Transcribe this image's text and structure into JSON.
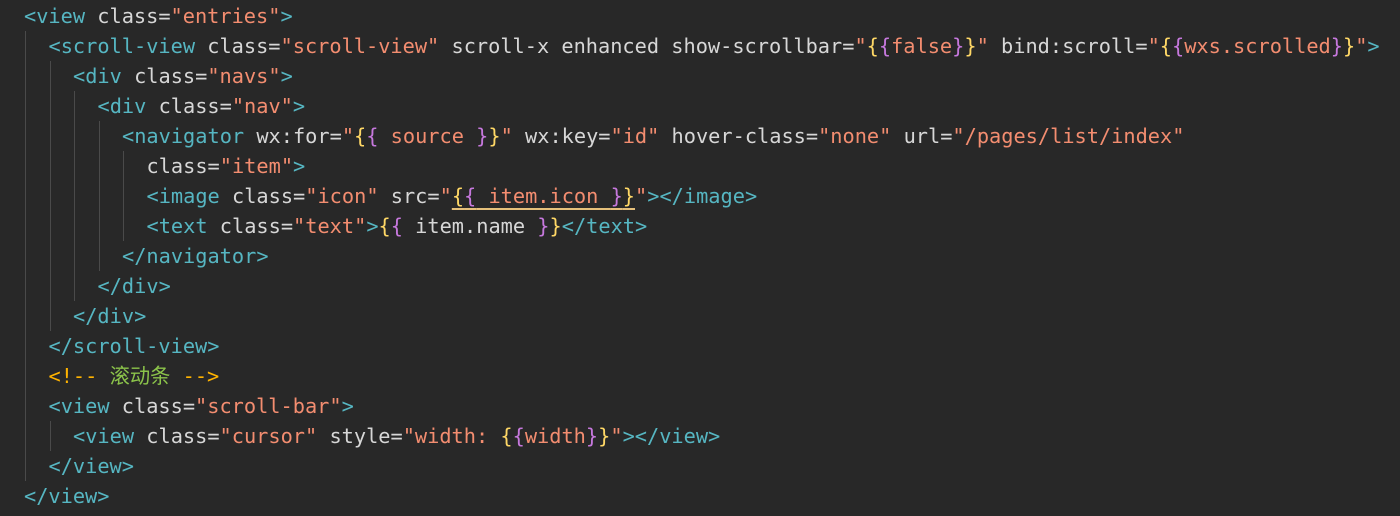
{
  "theme": {
    "background": "#282828",
    "tag": "#56b6c2",
    "bracket": "#56b6c2",
    "attr": "#d7d7d7",
    "string": "#f38d70",
    "brace_yellow": "#ffd866",
    "brace_magenta": "#c678dd",
    "expr": "#d7d7d7",
    "comment": "#8bc34a",
    "comment_delim": "#ffb300",
    "guide": "#4a4a4a"
  },
  "lines": [
    {
      "indent": 0,
      "tokens": [
        {
          "t": "<",
          "k": "tag"
        },
        {
          "t": "view",
          "k": "tag"
        },
        {
          "t": " class=",
          "k": "attr"
        },
        {
          "t": "\"entries\"",
          "k": "string"
        },
        {
          "t": ">",
          "k": "tag"
        }
      ]
    },
    {
      "indent": 1,
      "tokens": [
        {
          "t": "<",
          "k": "tag"
        },
        {
          "t": "scroll-view",
          "k": "tag"
        },
        {
          "t": " class=",
          "k": "attr"
        },
        {
          "t": "\"scroll-view\"",
          "k": "string"
        },
        {
          "t": " scroll-x enhanced show-scrollbar=",
          "k": "attr"
        },
        {
          "t": "\"",
          "k": "string"
        },
        {
          "t": "{",
          "k": "brace_yellow"
        },
        {
          "t": "{",
          "k": "brace_magenta"
        },
        {
          "t": "false",
          "k": "string"
        },
        {
          "t": "}",
          "k": "brace_magenta"
        },
        {
          "t": "}",
          "k": "brace_yellow"
        },
        {
          "t": "\"",
          "k": "string"
        },
        {
          "t": " bind:scroll=",
          "k": "attr"
        },
        {
          "t": "\"",
          "k": "string"
        },
        {
          "t": "{",
          "k": "brace_yellow"
        },
        {
          "t": "{",
          "k": "brace_magenta"
        },
        {
          "t": "wxs.scrolled",
          "k": "string"
        },
        {
          "t": "}",
          "k": "brace_magenta"
        },
        {
          "t": "}",
          "k": "brace_yellow"
        },
        {
          "t": "\"",
          "k": "string"
        },
        {
          "t": ">",
          "k": "tag"
        }
      ]
    },
    {
      "indent": 2,
      "tokens": [
        {
          "t": "<",
          "k": "tag"
        },
        {
          "t": "div",
          "k": "tag"
        },
        {
          "t": " class=",
          "k": "attr"
        },
        {
          "t": "\"navs\"",
          "k": "string"
        },
        {
          "t": ">",
          "k": "tag"
        }
      ]
    },
    {
      "indent": 3,
      "tokens": [
        {
          "t": "<",
          "k": "tag"
        },
        {
          "t": "div",
          "k": "tag"
        },
        {
          "t": " class=",
          "k": "attr"
        },
        {
          "t": "\"nav\"",
          "k": "string"
        },
        {
          "t": ">",
          "k": "tag"
        }
      ]
    },
    {
      "indent": 4,
      "tokens": [
        {
          "t": "<",
          "k": "tag"
        },
        {
          "t": "navigator",
          "k": "tag"
        },
        {
          "t": " wx:for=",
          "k": "attr"
        },
        {
          "t": "\"",
          "k": "string"
        },
        {
          "t": "{",
          "k": "brace_yellow"
        },
        {
          "t": "{",
          "k": "brace_magenta"
        },
        {
          "t": " source ",
          "k": "string"
        },
        {
          "t": "}",
          "k": "brace_magenta"
        },
        {
          "t": "}",
          "k": "brace_yellow"
        },
        {
          "t": "\"",
          "k": "string"
        },
        {
          "t": " wx:key=",
          "k": "attr"
        },
        {
          "t": "\"id\"",
          "k": "string"
        },
        {
          "t": " hover-class=",
          "k": "attr"
        },
        {
          "t": "\"none\"",
          "k": "string"
        },
        {
          "t": " url=",
          "k": "attr"
        },
        {
          "t": "\"/pages/list/index\"",
          "k": "string"
        }
      ]
    },
    {
      "indent": 5,
      "tokens": [
        {
          "t": "class=",
          "k": "attr"
        },
        {
          "t": "\"item\"",
          "k": "string"
        },
        {
          "t": ">",
          "k": "tag"
        }
      ]
    },
    {
      "indent": 5,
      "tokens": [
        {
          "t": "<",
          "k": "tag"
        },
        {
          "t": "image",
          "k": "tag"
        },
        {
          "t": " class=",
          "k": "attr"
        },
        {
          "t": "\"icon\"",
          "k": "string"
        },
        {
          "t": " src=",
          "k": "attr"
        },
        {
          "t": "\"",
          "k": "string"
        },
        {
          "t": "{",
          "k": "brace_yellow",
          "u": true
        },
        {
          "t": "{",
          "k": "brace_magenta",
          "u": true
        },
        {
          "t": " item.icon ",
          "k": "string",
          "u": true
        },
        {
          "t": "}",
          "k": "brace_magenta",
          "u": true
        },
        {
          "t": "}",
          "k": "brace_yellow",
          "u": true
        },
        {
          "t": "\"",
          "k": "string"
        },
        {
          "t": "></",
          "k": "tag"
        },
        {
          "t": "image",
          "k": "tag"
        },
        {
          "t": ">",
          "k": "tag"
        }
      ]
    },
    {
      "indent": 5,
      "tokens": [
        {
          "t": "<",
          "k": "tag"
        },
        {
          "t": "text",
          "k": "tag"
        },
        {
          "t": " class=",
          "k": "attr"
        },
        {
          "t": "\"text\"",
          "k": "string"
        },
        {
          "t": ">",
          "k": "tag"
        },
        {
          "t": "{",
          "k": "brace_yellow"
        },
        {
          "t": "{",
          "k": "brace_magenta"
        },
        {
          "t": " item.name ",
          "k": "expr"
        },
        {
          "t": "}",
          "k": "brace_magenta"
        },
        {
          "t": "}",
          "k": "brace_yellow"
        },
        {
          "t": "</",
          "k": "tag"
        },
        {
          "t": "text",
          "k": "tag"
        },
        {
          "t": ">",
          "k": "tag"
        }
      ]
    },
    {
      "indent": 4,
      "tokens": [
        {
          "t": "</",
          "k": "tag"
        },
        {
          "t": "navigator",
          "k": "tag"
        },
        {
          "t": ">",
          "k": "tag"
        }
      ]
    },
    {
      "indent": 3,
      "tokens": [
        {
          "t": "</",
          "k": "tag"
        },
        {
          "t": "div",
          "k": "tag"
        },
        {
          "t": ">",
          "k": "tag"
        }
      ]
    },
    {
      "indent": 2,
      "tokens": [
        {
          "t": "</",
          "k": "tag"
        },
        {
          "t": "div",
          "k": "tag"
        },
        {
          "t": ">",
          "k": "tag"
        }
      ]
    },
    {
      "indent": 1,
      "tokens": [
        {
          "t": "</",
          "k": "tag"
        },
        {
          "t": "scroll-view",
          "k": "tag"
        },
        {
          "t": ">",
          "k": "tag"
        }
      ]
    },
    {
      "indent": 1,
      "tokens": [
        {
          "t": "<!-- ",
          "k": "comment_delim"
        },
        {
          "t": "滚动条",
          "k": "comment"
        },
        {
          "t": " -->",
          "k": "comment_delim"
        }
      ]
    },
    {
      "indent": 1,
      "tokens": [
        {
          "t": "<",
          "k": "tag"
        },
        {
          "t": "view",
          "k": "tag"
        },
        {
          "t": " class=",
          "k": "attr"
        },
        {
          "t": "\"scroll-bar\"",
          "k": "string"
        },
        {
          "t": ">",
          "k": "tag"
        }
      ]
    },
    {
      "indent": 2,
      "tokens": [
        {
          "t": "<",
          "k": "tag"
        },
        {
          "t": "view",
          "k": "tag"
        },
        {
          "t": " class=",
          "k": "attr"
        },
        {
          "t": "\"cursor\"",
          "k": "string"
        },
        {
          "t": " style=",
          "k": "attr"
        },
        {
          "t": "\"width: ",
          "k": "string"
        },
        {
          "t": "{",
          "k": "brace_yellow"
        },
        {
          "t": "{",
          "k": "brace_magenta"
        },
        {
          "t": "width",
          "k": "string"
        },
        {
          "t": "}",
          "k": "brace_magenta"
        },
        {
          "t": "}",
          "k": "brace_yellow"
        },
        {
          "t": "\"",
          "k": "string"
        },
        {
          "t": "></",
          "k": "tag"
        },
        {
          "t": "view",
          "k": "tag"
        },
        {
          "t": ">",
          "k": "tag"
        }
      ]
    },
    {
      "indent": 1,
      "tokens": [
        {
          "t": "</",
          "k": "tag"
        },
        {
          "t": "view",
          "k": "tag"
        },
        {
          "t": ">",
          "k": "tag"
        }
      ]
    },
    {
      "indent": 0,
      "tokens": [
        {
          "t": "</",
          "k": "tag"
        },
        {
          "t": "view",
          "k": "tag"
        },
        {
          "t": ">",
          "k": "tag"
        }
      ]
    }
  ]
}
